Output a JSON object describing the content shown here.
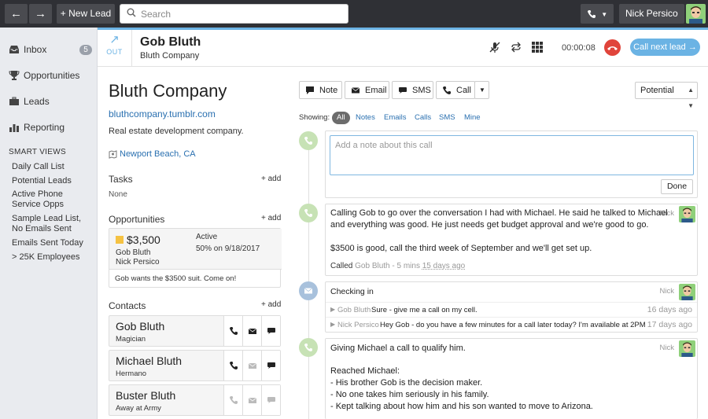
{
  "topbar": {
    "back_icon": "arrow-left",
    "forward_icon": "arrow-right",
    "new_lead_label": "+ New Lead",
    "search_placeholder": "Search",
    "user_name": "Nick Persico",
    "phone_icon": "phone-icon"
  },
  "sidebar": {
    "items": [
      {
        "label": "Inbox",
        "icon": "inbox-icon",
        "badge": "5"
      },
      {
        "label": "Opportunities",
        "icon": "trophy-icon"
      },
      {
        "label": "Leads",
        "icon": "briefcase-icon"
      },
      {
        "label": "Reporting",
        "icon": "bar-chart-icon"
      }
    ],
    "smart_views_heading": "SMART VIEWS",
    "smart_views": [
      "Daily Call List",
      "Potential Leads",
      "Active Phone Service Opps",
      "Sample Lead List, No Emails Sent",
      "Emails Sent Today",
      "> 25K Employees"
    ]
  },
  "call": {
    "direction": "OUT",
    "contact_name": "Gob Bluth",
    "company": "Bluth Company",
    "timer": "00:00:08",
    "next_lead_label": "Call next lead →"
  },
  "lead": {
    "name": "Bluth Company",
    "url": "bluthcompany.tumblr.com",
    "description": "Real estate development company.",
    "location": "Newport Beach, CA",
    "tasks_heading": "Tasks",
    "add_label": "+ add",
    "tasks_none": "None",
    "opportunities_heading": "Opportunities",
    "opportunity": {
      "amount": "$3,500",
      "contact": "Gob Bluth",
      "owner": "Nick Persico",
      "status": "Active",
      "confidence": "50% on 9/18/2017",
      "note": "Gob wants the $3500 suit. Come on!",
      "status_color": "#f5c242"
    },
    "contacts_heading": "Contacts",
    "contacts": [
      {
        "name": "Gob Bluth",
        "title": "Magician"
      },
      {
        "name": "Michael Bluth",
        "title": "Hermano"
      },
      {
        "name": "Buster Bluth",
        "title": "Away at Army"
      }
    ]
  },
  "actions": {
    "note_label": "Note",
    "email_label": "Email",
    "sms_label": "SMS",
    "call_label": "Call",
    "status_value": "Potential"
  },
  "filters": {
    "label": "Showing:",
    "items": [
      "All",
      "Notes",
      "Emails",
      "Calls",
      "SMS",
      "Mine"
    ]
  },
  "note_input": {
    "placeholder": "Add a note about this call",
    "done_label": "Done"
  },
  "activities": {
    "call1": {
      "author": "Nick",
      "text1": "Calling Gob to go over the conversation I had with Michael. He said he talked to Michael",
      "text2": "and everything was good. He just needs get budget approval and we're good to go.",
      "text3": "$3500 is good, call the third week of September and we'll get set up.",
      "meta_prefix": "Called",
      "meta_who": "Gob Bluth",
      "meta_dur": "- 5 mins",
      "meta_when": "15 days ago"
    },
    "email_thread": {
      "subject": "Checking in",
      "author": "Nick",
      "rows": [
        {
          "from": "Gob Bluth",
          "msg": "Sure - give me a call on my cell.",
          "when": "16 days ago"
        },
        {
          "from": "Nick Persico",
          "msg": "Hey Gob - do you have a few minutes for a call later today? I'm available at 2PM",
          "when": "17 days ago"
        }
      ]
    },
    "call2": {
      "author": "Nick",
      "line1": "Giving Michael a call to qualify him.",
      "line2": "Reached Michael:",
      "line3": "- His brother Gob is the decision maker.",
      "line4": "- No one takes him seriously in his family.",
      "line5": "- Kept talking about how him and his son wanted to move to Arizona."
    }
  },
  "colors": {
    "accent": "#6bb3e4",
    "hangup": "#e0443b",
    "link": "#2a70b0"
  }
}
